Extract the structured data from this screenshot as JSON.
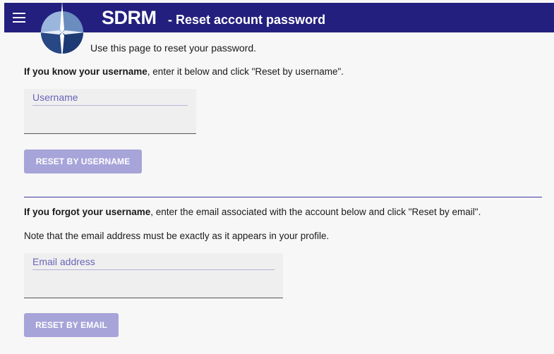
{
  "header": {
    "app_name": "SDRM",
    "page_title": "- Reset account password",
    "background_color": "#231f7e"
  },
  "intro": "Use this page to reset your password.",
  "username_section": {
    "instruction_bold": "If you know your username",
    "instruction_rest": ", enter it below and click \"Reset by username\".",
    "field_label": "Username",
    "field_value": "",
    "button_label": "RESET BY USERNAME"
  },
  "email_section": {
    "instruction_bold": "If you forgot your username",
    "instruction_rest": ", enter the email associated with the account below and click \"Reset by email\".",
    "note": "Note that the email address must be exactly as it appears in your profile.",
    "field_label": "Email address",
    "field_value": "",
    "button_label": "RESET BY EMAIL"
  },
  "colors": {
    "accent": "#231f7e",
    "button_disabled": "#a7a4d9",
    "label": "#6b64b8"
  },
  "icons": {
    "menu": "hamburger-menu-icon",
    "logo": "compass-logo"
  }
}
